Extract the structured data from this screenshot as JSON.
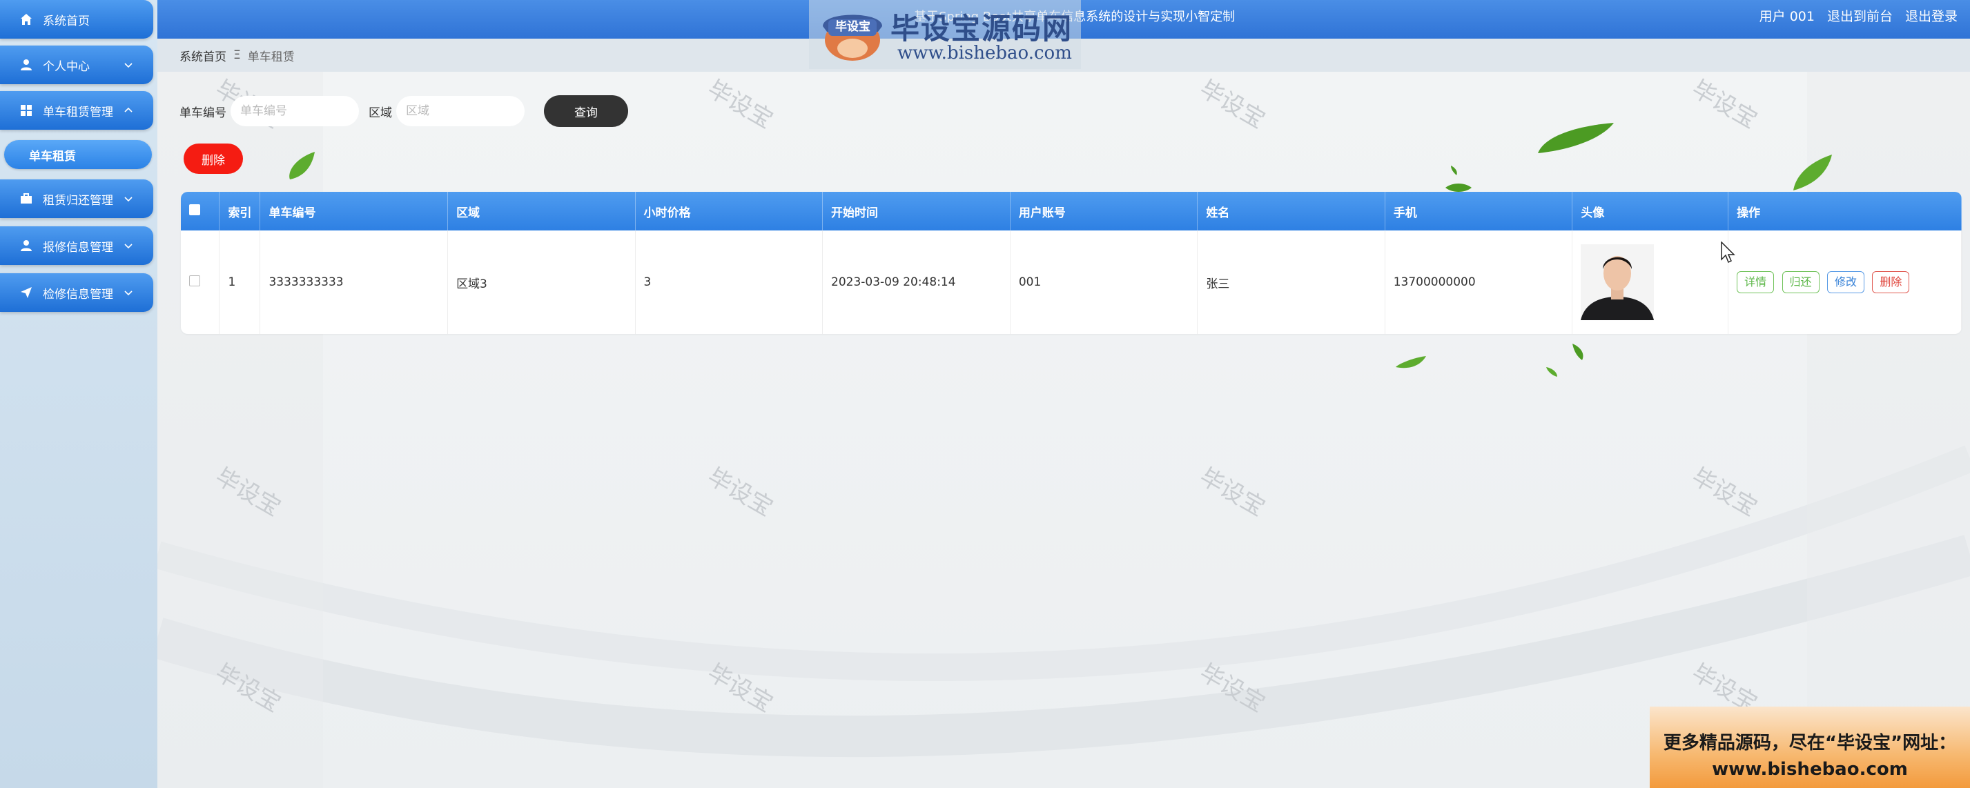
{
  "header": {
    "system_title": "基于Spring Boot共享单车信息系统的设计与实现小智定制",
    "user_label": "用户 001",
    "front_link": "退出到前台",
    "logout_link": "退出登录"
  },
  "logo": {
    "mark_text": "毕设宝",
    "title": "毕设宝源码网",
    "url": "www.bishebao.com"
  },
  "sidebar": {
    "items": [
      {
        "label": "系统首页",
        "icon": "home-icon"
      },
      {
        "label": "个人中心",
        "icon": "user-icon"
      },
      {
        "label": "单车租赁管理",
        "icon": "grid-icon"
      },
      {
        "label": "租赁归还管理",
        "icon": "briefcase-icon"
      },
      {
        "label": "报修信息管理",
        "icon": "user-icon"
      },
      {
        "label": "检修信息管理",
        "icon": "send-icon"
      }
    ],
    "sub_item": "单车租赁"
  },
  "breadcrumb": {
    "home": "系统首页",
    "separator": "Ξ",
    "current": "单车租赁"
  },
  "search": {
    "bike_no_label": "单车编号",
    "bike_no_placeholder": "单车编号",
    "area_label": "区域",
    "area_placeholder": "区域",
    "query_button": "查询"
  },
  "actions": {
    "delete_button": "删除"
  },
  "table": {
    "columns": [
      "索引",
      "单车编号",
      "区域",
      "小时价格",
      "开始时间",
      "用户账号",
      "姓名",
      "手机",
      "头像",
      "操作"
    ],
    "rows": [
      {
        "index": "1",
        "bike_no": "3333333333",
        "area": "区域3",
        "hour_price": "3",
        "start_time": "2023-03-09 20:48:14",
        "user_account": "001",
        "name": "张三",
        "phone": "13700000000",
        "ops": {
          "detail": "详情",
          "return": "归还",
          "edit": "修改",
          "delete": "删除"
        }
      }
    ]
  },
  "watermark": "毕设宝",
  "promo": {
    "line1": "更多精品源码，尽在“毕设宝”网址：",
    "line2": "www.bishebao.com"
  },
  "colors": {
    "primary_blue": "#2f73d6",
    "delete_red": "#f51c12",
    "query_dark": "#333333",
    "promo_orange": "#f39a3c"
  }
}
